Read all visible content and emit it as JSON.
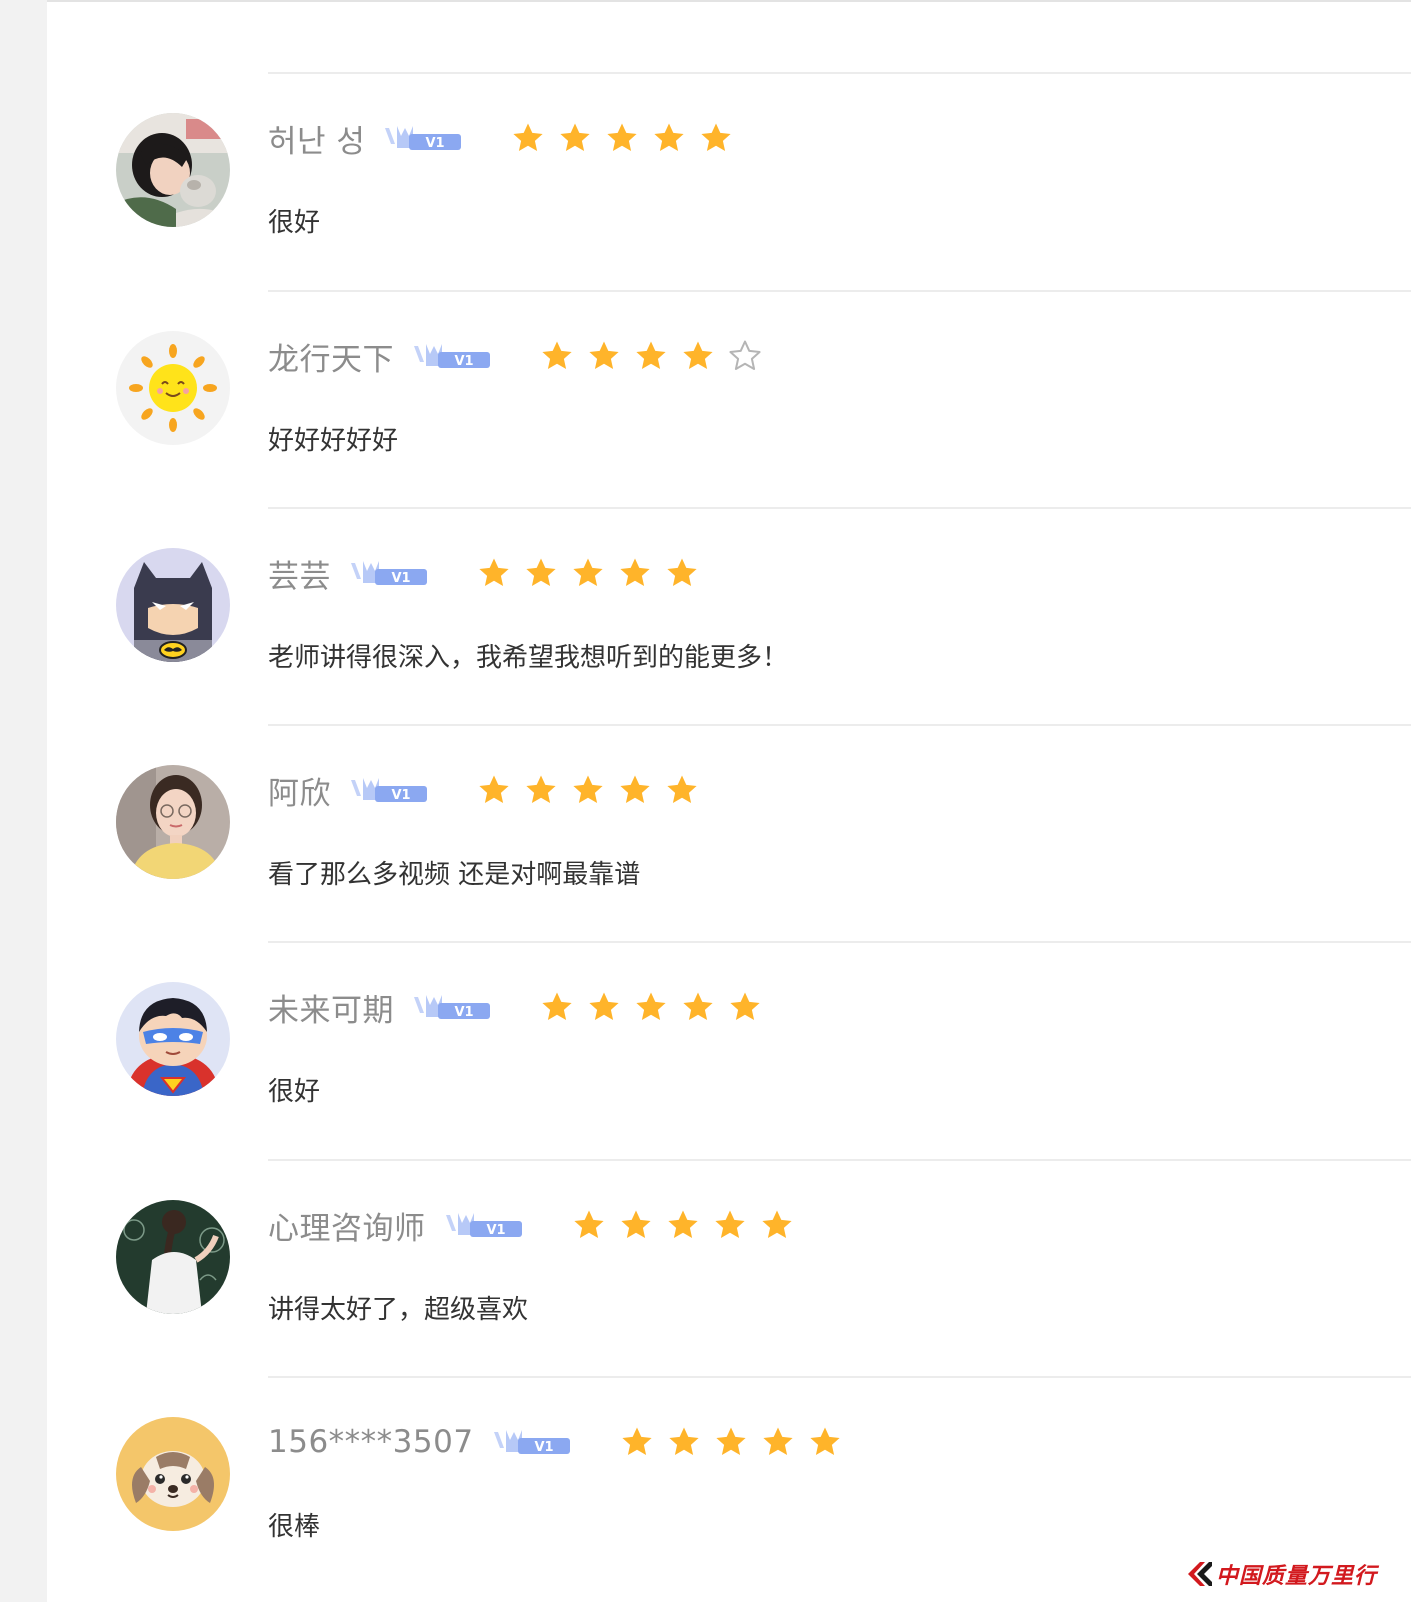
{
  "colors": {
    "star_fill": "#ffb42a",
    "star_empty_stroke": "#b5b5b5",
    "vip_badge": "#7c9cf0",
    "username": "#8c8c8c",
    "comment": "#333333",
    "watermark": "#d2191e"
  },
  "reviews": [
    {
      "username": "허난 성",
      "vip_level": "V1",
      "rating": 5,
      "max_rating": 5,
      "comment": "很好",
      "avatar": "girl-with-cat-photo"
    },
    {
      "username": "龙行天下",
      "vip_level": "V1",
      "rating": 4,
      "max_rating": 5,
      "comment": "好好好好好",
      "avatar": "cartoon-sun"
    },
    {
      "username": "芸芸",
      "vip_level": "V1",
      "rating": 5,
      "max_rating": 5,
      "comment": "老师讲得很深入，我希望我想听到的能更多！",
      "avatar": "cartoon-batman"
    },
    {
      "username": "阿欣",
      "vip_level": "V1",
      "rating": 5,
      "max_rating": 5,
      "comment": "看了那么多视频 还是对啊最靠谱",
      "avatar": "woman-with-glasses-photo"
    },
    {
      "username": "未来可期",
      "vip_level": "V1",
      "rating": 5,
      "max_rating": 5,
      "comment": "很好",
      "avatar": "cartoon-superman"
    },
    {
      "username": "心理咨询师",
      "vip_level": "V1",
      "rating": 5,
      "max_rating": 5,
      "comment": "讲得太好了，超级喜欢",
      "avatar": "girl-at-chalkboard-photo"
    },
    {
      "username": "156****3507",
      "vip_level": "V1",
      "rating": 5,
      "max_rating": 5,
      "comment": "很棒",
      "avatar": "cartoon-puppy"
    }
  ],
  "watermark": {
    "text": "中国质量万里行",
    "icon": "brand-logo-icon"
  }
}
